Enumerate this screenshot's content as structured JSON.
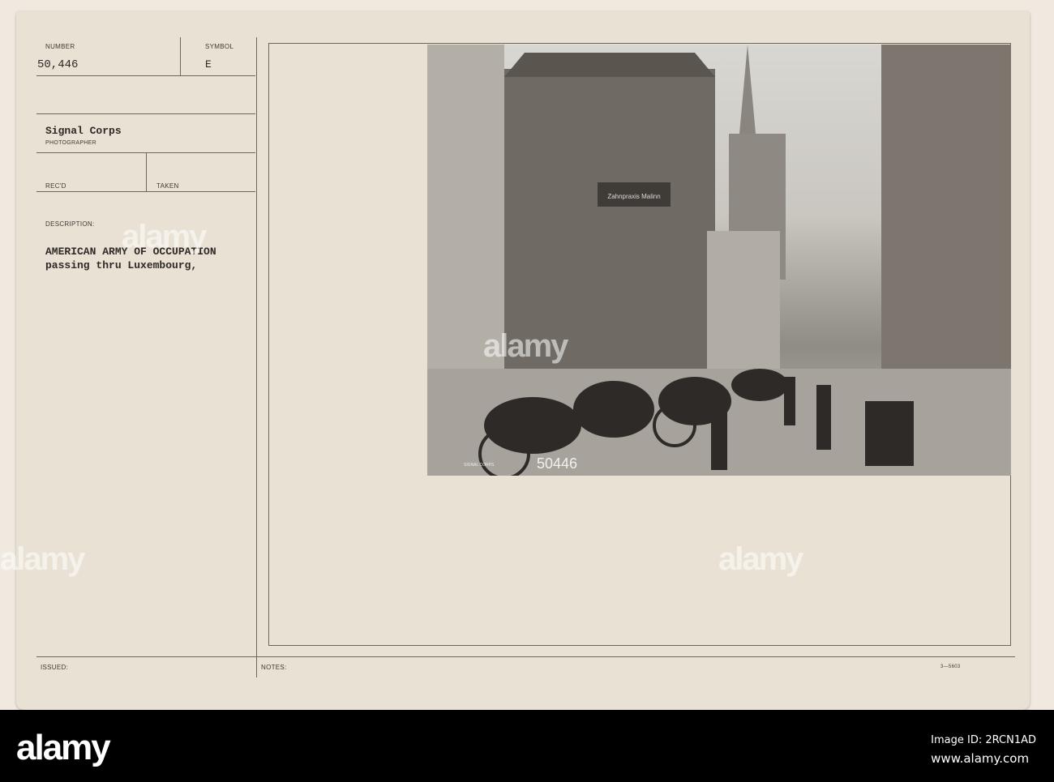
{
  "card": {
    "number_label": "NUMBER",
    "number": "50,446",
    "symbol_label": "SYMBOL",
    "symbol": "E",
    "photographer": "Signal Corps",
    "photographer_label": "PHOTOGRAPHER",
    "recd_label": "REC'D",
    "taken_label": "TAKEN",
    "description_label": "DESCRIPTION:",
    "description_line1": "AMERICAN ARMY OF OCCUPATION",
    "description_line2": "passing thru Luxembourg,",
    "issued_label": "ISSUED:",
    "notes_label": "NOTES:",
    "form_code": "3—5603"
  },
  "photo": {
    "negative_number": "50446",
    "shop_sign": "Zahnpraxis Malinn",
    "stamp": "SIGNAL CORPS"
  },
  "footer": {
    "logo": "alamy",
    "image_id": "Image ID: 2RCN1AD",
    "url": "www.alamy.com"
  },
  "watermark": "alamy"
}
